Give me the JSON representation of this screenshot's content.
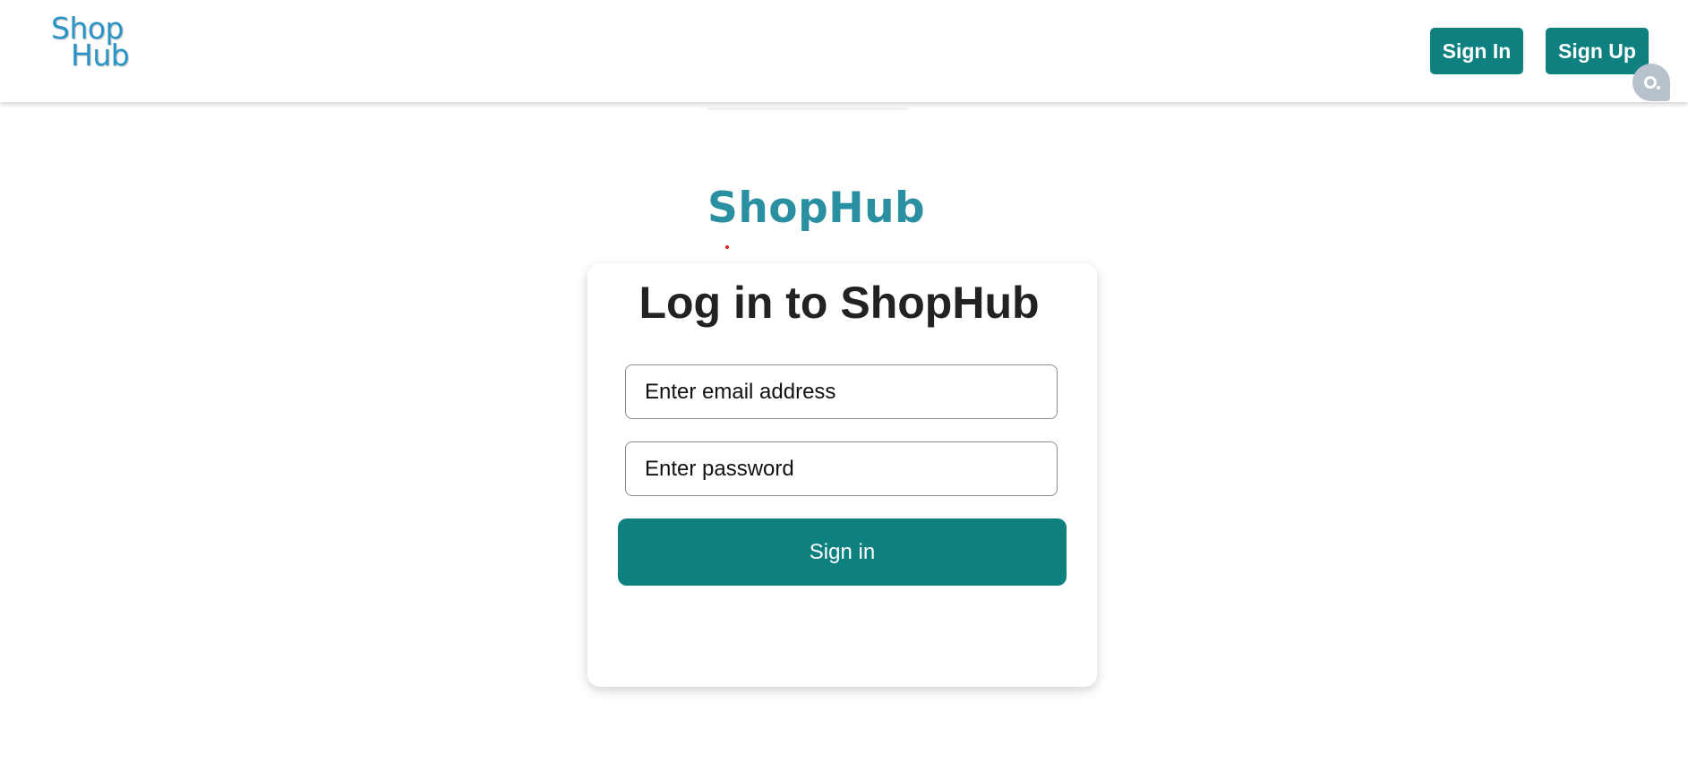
{
  "header": {
    "logo_line1": "Shop",
    "logo_line2": "Hub",
    "signin_label": "Sign In",
    "signup_label": "Sign Up"
  },
  "assistant": {
    "icon": "assistant-bubble-icon"
  },
  "brand": {
    "name": "ShopHub"
  },
  "login": {
    "title": "Log in to ShopHub",
    "email_placeholder": "Enter email address",
    "password_placeholder": "Enter password",
    "submit_label": "Sign in"
  },
  "colors": {
    "primary": "#0e8080",
    "logo": "#2b94c7",
    "brand": "#2a8fa0",
    "assistant": "#b7c2cc"
  }
}
